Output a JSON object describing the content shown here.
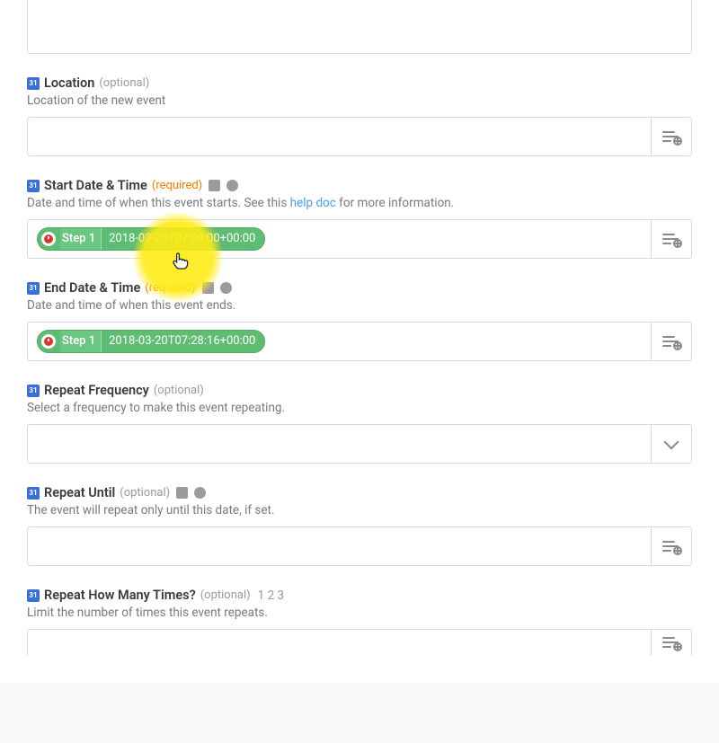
{
  "icons": {
    "cal": "31"
  },
  "pill": {
    "step": "Step 1"
  },
  "fields": {
    "location": {
      "label": "Location",
      "optionality": "(optional)",
      "hint": "Location of the new event"
    },
    "start": {
      "label": "Start Date & Time",
      "optionality": "(required)",
      "hint_pre": "Date and time of when this event starts. See this ",
      "hint_link": "help doc",
      "hint_post": " for more information.",
      "pill_value": "2018-03-20T07:00:00+00:00"
    },
    "end": {
      "label": "End Date & Time",
      "optionality": "(required)",
      "hint": "Date and time of when this event ends.",
      "pill_value": "2018-03-20T07:28:16+00:00"
    },
    "repeat_freq": {
      "label": "Repeat Frequency",
      "optionality": "(optional)",
      "hint": "Select a frequency to make this event repeating."
    },
    "repeat_until": {
      "label": "Repeat Until",
      "optionality": "(optional)",
      "hint": "The event will repeat only until this date, if set."
    },
    "repeat_count": {
      "label": "Repeat How Many Times?",
      "optionality": "(optional)",
      "example": "1 2 3",
      "hint": "Limit the number of times this event repeats."
    }
  }
}
